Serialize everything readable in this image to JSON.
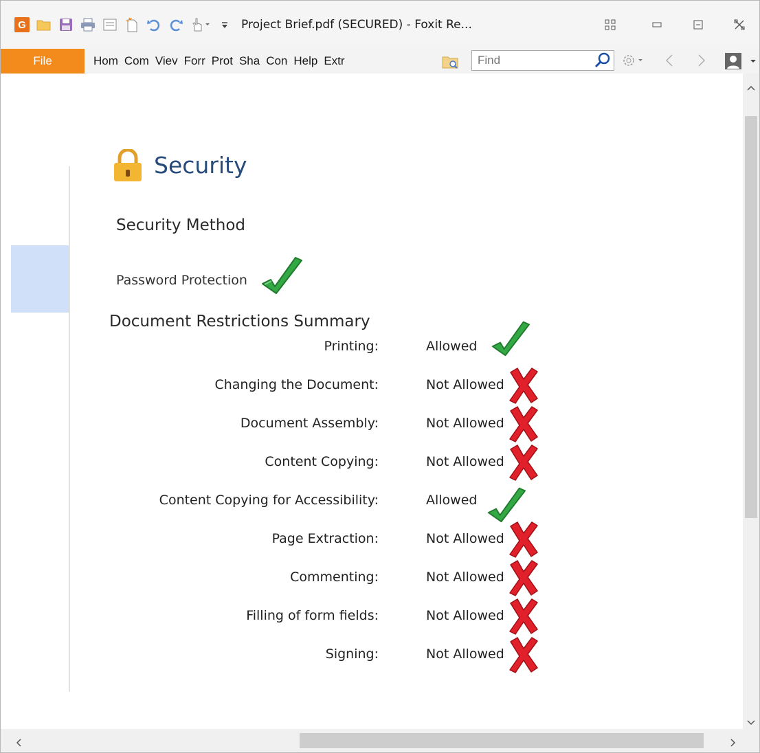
{
  "window": {
    "title": "Project Brief.pdf (SECURED) - Foxit Re..."
  },
  "toolbar": {
    "file_label": "File",
    "tabs": [
      "Hom",
      "Com",
      "Viev",
      "Forr",
      "Prot",
      "Sha",
      "Con",
      "Help",
      "Extr"
    ],
    "search_placeholder": "Find"
  },
  "security": {
    "title": "Security",
    "method_heading": "Security Method",
    "method": "Password Protection",
    "restrictions_heading": "Document Restrictions Summary",
    "restrictions": [
      {
        "label": "Printing:",
        "value": "Allowed",
        "allowed": true
      },
      {
        "label": "Changing the Document:",
        "value": "Not Allowed",
        "allowed": false
      },
      {
        "label": "Document Assembly:",
        "value": "Not Allowed",
        "allowed": false
      },
      {
        "label": "Content Copying:",
        "value": "Not Allowed",
        "allowed": false
      },
      {
        "label": "Content Copying for Accessibility:",
        "value": "Allowed",
        "allowed": true
      },
      {
        "label": "Page Extraction:",
        "value": "Not Allowed",
        "allowed": false
      },
      {
        "label": "Commenting:",
        "value": "Not Allowed",
        "allowed": false
      },
      {
        "label": "Filling of form fields:",
        "value": "Not Allowed",
        "allowed": false
      },
      {
        "label": "Signing:",
        "value": "Not Allowed",
        "allowed": false
      }
    ]
  },
  "colors": {
    "accent": "#f38a1c",
    "title_blue": "#274b7a",
    "check_green": "#3bb54a",
    "cross_red": "#e0202a"
  }
}
